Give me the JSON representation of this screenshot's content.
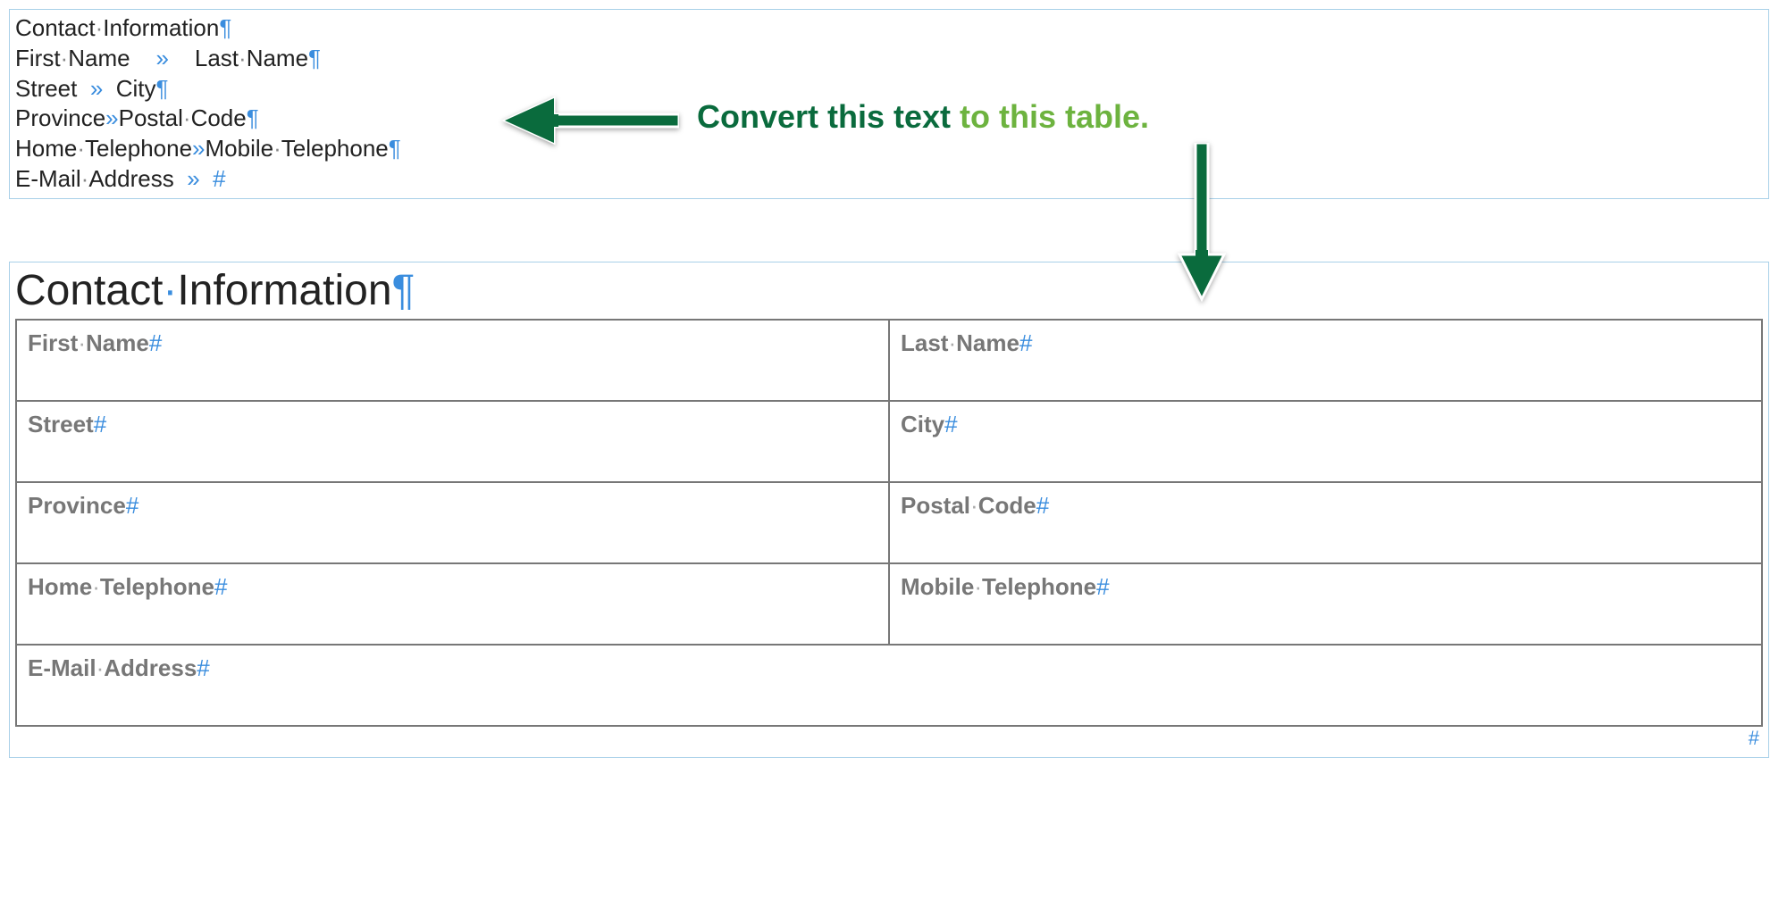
{
  "textblock": {
    "line0": "Contact·Information",
    "fn": "First·Name",
    "ln": "Last·Name",
    "street": "Street",
    "city": "City",
    "prov": "Province",
    "postal": "Postal·Code",
    "home": "Home·Telephone",
    "mobile": "Mobile·Telephone",
    "email": "E-Mail·Address"
  },
  "annotation": {
    "part1": "Convert this text ",
    "part2": "to this table."
  },
  "table": {
    "heading_a": "Contact",
    "heading_b": "Information",
    "rows": {
      "r0c0": "First·Name",
      "r0c1": "Last·Name",
      "r1c0": "Street",
      "r1c1": "City",
      "r2c0": "Province",
      "r2c1": "Postal·Code",
      "r3c0": "Home·Telephone",
      "r3c1": "Mobile·Telephone",
      "r4c0": "E-Mail·Address"
    }
  },
  "marks": {
    "pilcrow": "¶",
    "tab": "»",
    "hash": "#",
    "dot": "·"
  }
}
